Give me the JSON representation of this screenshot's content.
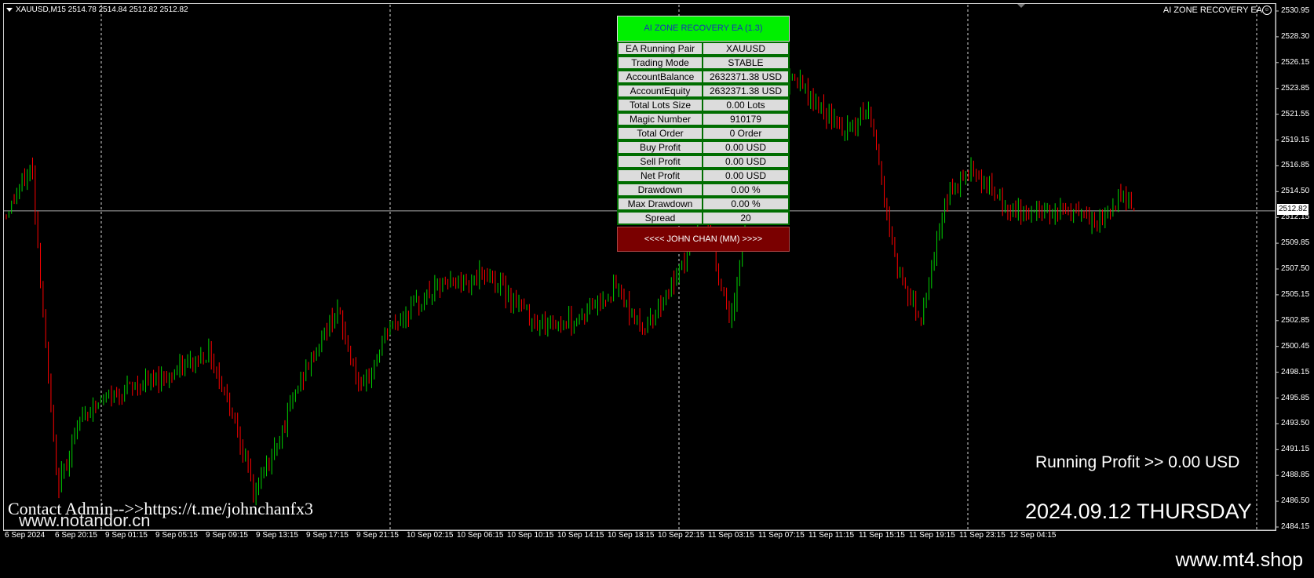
{
  "window": {
    "symbol_label": "XAUUSD,M15  2514.78 2514.84 2512.82 2512.82",
    "ea_name": "AI ZONE RECOVERY EA",
    "ea_status_icon": "smiley-icon"
  },
  "colors": {
    "background": "#000000",
    "bull_candle": "#00d200",
    "bear_candle": "#ff0000",
    "grid": "#ffffff",
    "ea_header": "#00f000",
    "ea_header_text": "#1a32b8",
    "ea_cell_bg": "#dcdcdc",
    "ea_cell_border": "#006d00",
    "ea_footer": "#7a0000"
  },
  "price_axis": {
    "ticks": [
      "2530.95",
      "2528.30",
      "2526.15",
      "2523.85",
      "2521.55",
      "2519.15",
      "2516.85",
      "2514.50",
      "2512.15",
      "2509.85",
      "2507.50",
      "2505.15",
      "2502.85",
      "2500.45",
      "2498.15",
      "2495.85",
      "2493.50",
      "2491.15",
      "2488.85",
      "2486.50",
      "2484.15"
    ],
    "current_price": "2512.82"
  },
  "time_axis": {
    "ticks": [
      "6 Sep 2024",
      "6 Sep 20:15",
      "9 Sep 01:15",
      "9 Sep 05:15",
      "9 Sep 09:15",
      "9 Sep 13:15",
      "9 Sep 17:15",
      "9 Sep 21:15",
      "10 Sep 02:15",
      "10 Sep 06:15",
      "10 Sep 10:15",
      "10 Sep 14:15",
      "10 Sep 18:15",
      "10 Sep 22:15",
      "11 Sep 03:15",
      "11 Sep 07:15",
      "11 Sep 11:15",
      "11 Sep 15:15",
      "11 Sep 19:15",
      "11 Sep 23:15",
      "12 Sep 04:15"
    ]
  },
  "ea_panel": {
    "title": "AI ZONE RECOVERY EA (1.3)",
    "rows": [
      {
        "label": "EA Running Pair",
        "value": "XAUUSD"
      },
      {
        "label": "Trading Mode",
        "value": "STABLE"
      },
      {
        "label": "AccountBalance",
        "value": "2632371.38 USD"
      },
      {
        "label": "AccountEquity",
        "value": "2632371.38 USD"
      },
      {
        "label": "Total Lots Size",
        "value": "0.00 Lots"
      },
      {
        "label": "Magic Number",
        "value": "910179"
      },
      {
        "label": "Total Order",
        "value": "0 Order"
      },
      {
        "label": "Buy Profit",
        "value": "0.00 USD"
      },
      {
        "label": "Sell Profit",
        "value": "0.00 USD"
      },
      {
        "label": "Net Profit",
        "value": "0.00 USD"
      },
      {
        "label": "Drawdown",
        "value": "0.00 %"
      },
      {
        "label": "Max Drawdown",
        "value": "0.00 %"
      },
      {
        "label": "Spread",
        "value": "20"
      }
    ],
    "footer": "<<<< JOHN CHAN (MM) >>>>"
  },
  "overlay": {
    "contact": "Contact Admin-->>https://t.me/johnchanfx3",
    "watermark_left": "www.notandor.cn",
    "running_profit": "Running Profit >> 0.00 USD",
    "date": "2024.09.12 THURSDAY",
    "watermark_right": "www.mt4.shop"
  },
  "chart_data": {
    "type": "candlestick",
    "symbol": "XAUUSD",
    "timeframe": "M15",
    "ylim": [
      2484.15,
      2530.95
    ],
    "last": 2512.82,
    "close_path": [
      {
        "t": 0,
        "p": 2512.5
      },
      {
        "t": 0.02,
        "p": 2517.0
      },
      {
        "t": 0.03,
        "p": 2502.0
      },
      {
        "t": 0.04,
        "p": 2487.5
      },
      {
        "t": 0.06,
        "p": 2494.5
      },
      {
        "t": 0.09,
        "p": 2496.5
      },
      {
        "t": 0.13,
        "p": 2498.0
      },
      {
        "t": 0.16,
        "p": 2500.0
      },
      {
        "t": 0.18,
        "p": 2494.0
      },
      {
        "t": 0.195,
        "p": 2487.0
      },
      {
        "t": 0.21,
        "p": 2491.0
      },
      {
        "t": 0.23,
        "p": 2497.0
      },
      {
        "t": 0.26,
        "p": 2504.0
      },
      {
        "t": 0.28,
        "p": 2496.0
      },
      {
        "t": 0.3,
        "p": 2502.0
      },
      {
        "t": 0.34,
        "p": 2506.0
      },
      {
        "t": 0.38,
        "p": 2507.0
      },
      {
        "t": 0.42,
        "p": 2502.5
      },
      {
        "t": 0.45,
        "p": 2503.0
      },
      {
        "t": 0.48,
        "p": 2506.0
      },
      {
        "t": 0.5,
        "p": 2502.0
      },
      {
        "t": 0.53,
        "p": 2507.0
      },
      {
        "t": 0.55,
        "p": 2513.5
      },
      {
        "t": 0.57,
        "p": 2502.0
      },
      {
        "t": 0.59,
        "p": 2519.0
      },
      {
        "t": 0.62,
        "p": 2525.0
      },
      {
        "t": 0.64,
        "p": 2522.0
      },
      {
        "t": 0.66,
        "p": 2520.0
      },
      {
        "t": 0.68,
        "p": 2522.0
      },
      {
        "t": 0.7,
        "p": 2508.0
      },
      {
        "t": 0.72,
        "p": 2503.0
      },
      {
        "t": 0.74,
        "p": 2514.0
      },
      {
        "t": 0.76,
        "p": 2517.0
      },
      {
        "t": 0.79,
        "p": 2512.5
      },
      {
        "t": 0.83,
        "p": 2513.0
      },
      {
        "t": 0.86,
        "p": 2511.5
      },
      {
        "t": 0.88,
        "p": 2514.5
      },
      {
        "t": 0.89,
        "p": 2512.8
      }
    ]
  }
}
